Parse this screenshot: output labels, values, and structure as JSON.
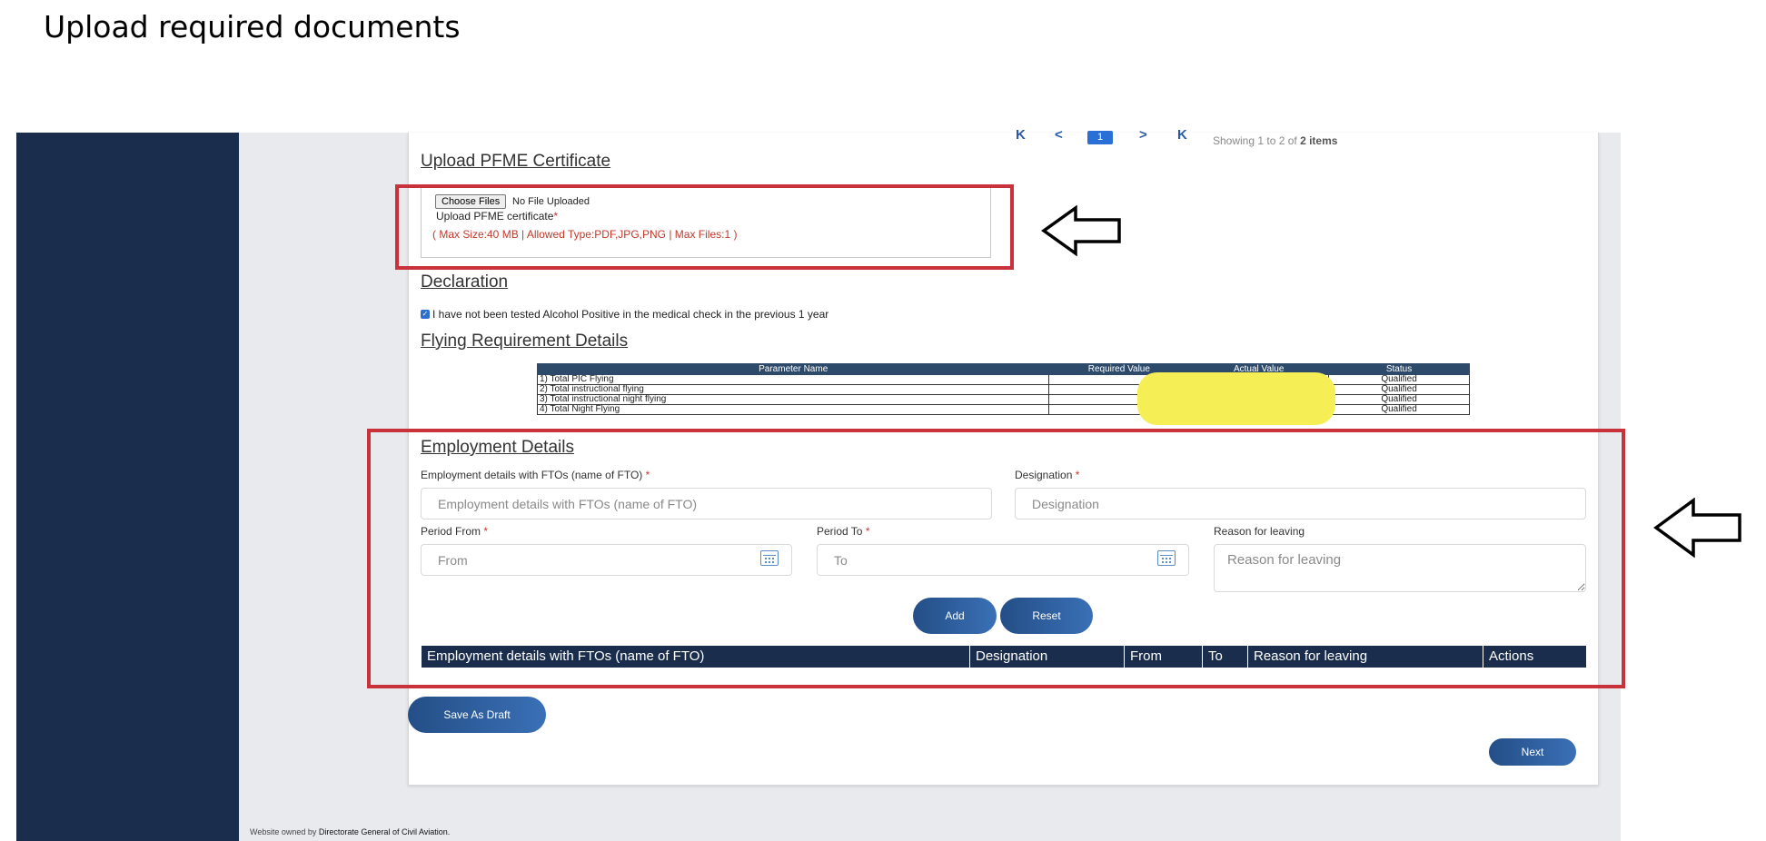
{
  "doc_title": "Upload required documents",
  "pagination": {
    "first": "K",
    "prev": "<",
    "current": "1",
    "next": ">",
    "last": "K",
    "info_prefix": "Showing 1 to 2 of",
    "info_total": "2 items"
  },
  "pfme": {
    "title": "Upload PFME Certificate",
    "choose_button": "Choose Files",
    "no_file": "No File Uploaded",
    "label": "Upload PFME certificate",
    "required_mark": "*",
    "hint": "( Max Size:40 MB | Allowed Type:PDF,JPG,PNG | Max Files:1 )"
  },
  "declaration": {
    "title": "Declaration",
    "text": "I have not been tested Alcohol Positive in the medical check in the previous 1 year",
    "checked": true
  },
  "flying": {
    "title": "Flying Requirement Details",
    "columns": [
      "Parameter Name",
      "Required Value",
      "Actual Value",
      "Status"
    ],
    "rows": [
      {
        "name": "1) Total PIC Flying",
        "required": "",
        "actual": "",
        "status": "Qualified"
      },
      {
        "name": "2) Total instructional flying",
        "required": "",
        "actual": "",
        "status": "Qualified"
      },
      {
        "name": "3) Total instructional night flying",
        "required": "",
        "actual": "",
        "status": "Qualified"
      },
      {
        "name": "4) Total Night Flying",
        "required": "",
        "actual": "",
        "status": "Qualified"
      }
    ]
  },
  "employment": {
    "title": "Employment Details",
    "fto_label": "Employment details with FTOs (name of FTO)",
    "fto_placeholder": "Employment details with FTOs (name of FTO)",
    "designation_label": "Designation",
    "designation_placeholder": "Designation",
    "from_label": "Period From",
    "from_placeholder": "From",
    "to_label": "Period To",
    "to_placeholder": "To",
    "reason_label": "Reason for leaving",
    "reason_placeholder": "Reason for leaving",
    "required_mark": "*",
    "add_button": "Add",
    "reset_button": "Reset",
    "table_columns": [
      "Employment details with FTOs (name of FTO)",
      "Designation",
      "From",
      "To",
      "Reason for leaving",
      "Actions"
    ]
  },
  "actions": {
    "save_draft": "Save As Draft",
    "next": "Next"
  },
  "footer": {
    "prefix": "Website owned by",
    "owner": "Directorate General of Civil Aviation."
  },
  "colors": {
    "sidebar": "#1b2d4d",
    "accent": "#2a6fd6",
    "annotation_red": "#c9323b",
    "redaction_yellow": "#f6ee55"
  }
}
